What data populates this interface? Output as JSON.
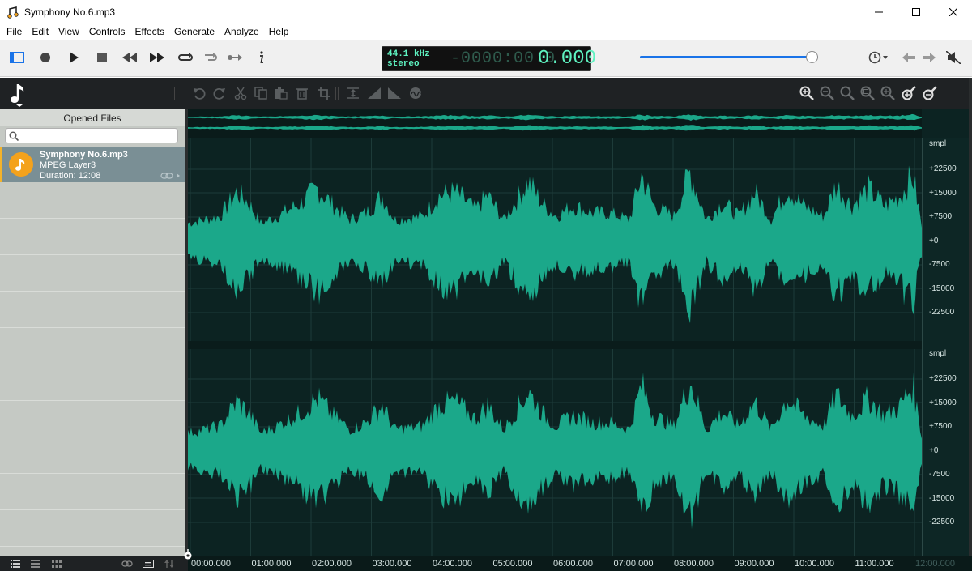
{
  "window": {
    "title": "Symphony No.6.mp3",
    "controls": {
      "minimize": "minimize-icon",
      "maximize": "maximize-icon",
      "close": "close-icon"
    }
  },
  "menu": [
    "File",
    "Edit",
    "View",
    "Controls",
    "Effects",
    "Generate",
    "Analyze",
    "Help"
  ],
  "toolbar": {
    "buttons": [
      "panel-toggle-icon",
      "record-icon",
      "play-icon",
      "stop-icon",
      "rewind-icon",
      "fast-forward-icon",
      "loop-icon",
      "repeat-icon",
      "skip-icon",
      "info-icon"
    ],
    "lcd": {
      "sample_rate": "44.1 kHz",
      "channels": "stereo",
      "time_dim": "-0000:00:0",
      "time": "0.000"
    },
    "volume_fraction": 0.97,
    "right_buttons": [
      "history-icon",
      "back-arrow-icon",
      "forward-arrow-icon",
      "mute-icon"
    ]
  },
  "edit_toolbar": {
    "buttons": [
      "undo-icon",
      "redo-icon",
      "cut-icon",
      "copy-icon",
      "paste-icon",
      "delete-icon",
      "crop-icon",
      "normalize-icon",
      "fade-in-icon",
      "fade-out-icon",
      "silence-icon"
    ],
    "zoom_buttons": [
      "zoom-in-icon",
      "zoom-out-icon",
      "zoom-fit-icon",
      "zoom-selection-icon",
      "zoom-full-icon",
      "zoom-vertical-in-icon",
      "zoom-vertical-out-icon"
    ]
  },
  "left_panel": {
    "title": "Opened Files",
    "search_placeholder": "",
    "files": [
      {
        "name": "Symphony No.6.mp3",
        "format": "MPEG Layer3",
        "duration": "Duration: 12:08"
      }
    ]
  },
  "waveform": {
    "unit": "smpl",
    "scale_labels": [
      "+22500",
      "+15000",
      "+7500",
      "+0",
      "-7500",
      "-15000",
      "-22500"
    ],
    "time_ticks": [
      "00:00.000",
      "01:00.000",
      "02:00.000",
      "03:00.000",
      "04:00.000",
      "05:00.000",
      "06:00.000",
      "07:00.000",
      "08:00.000",
      "09:00.000",
      "10:00.000",
      "11:00.000",
      "12:00.000"
    ]
  },
  "colors": {
    "accent": "#1a73e8",
    "waveform": "#1ba88a",
    "lcd_text": "#5ef2c0",
    "file_icon": "#f4a21c"
  }
}
